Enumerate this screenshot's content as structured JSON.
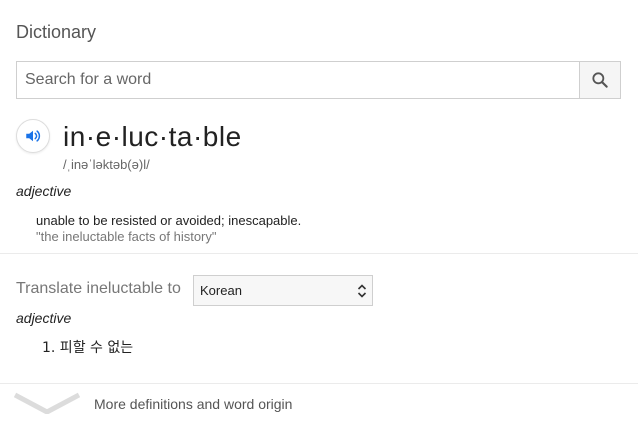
{
  "header": {
    "title": "Dictionary"
  },
  "search": {
    "placeholder": "Search for a word",
    "icon": "search-icon"
  },
  "entry": {
    "word": "in·e·luc·ta·ble",
    "phonetic": "/ˌinəˈləktəb(ə)l/",
    "audio_icon": "speaker-icon",
    "part_of_speech": "adjective",
    "definition": "unable to be resisted or avoided; inescapable.",
    "example": "\"the ineluctable facts of history\""
  },
  "translate": {
    "label": "Translate ineluctable to",
    "language": "Korean",
    "part_of_speech": "adjective",
    "result": "1. 피할 수 없는"
  },
  "footer": {
    "more_label": "More definitions and word origin",
    "chevron_icon": "chevron-down-icon"
  },
  "colors": {
    "accent": "#1a73e8",
    "muted": "#777777",
    "border": "#cfcfcf"
  }
}
